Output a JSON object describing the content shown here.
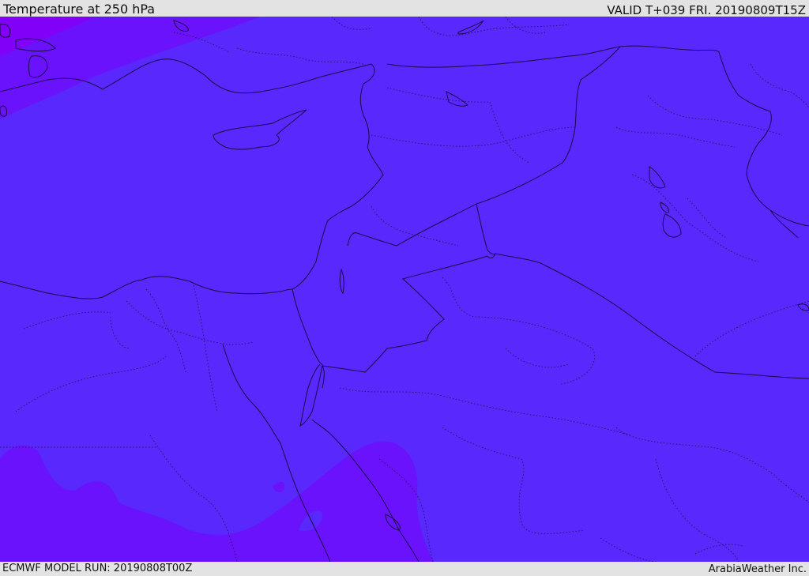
{
  "header": {
    "title": "Temperature at 250 hPa",
    "valid_time": "VALID T+039 FRI. 20190809T15Z"
  },
  "footer": {
    "model_run": "ECMWF MODEL RUN: 20190808T00Z",
    "credit": "ArabiaWeather Inc."
  },
  "map": {
    "region": "Eastern Mediterranean and Middle East",
    "colors": {
      "base": "#5828fc",
      "warm_band": "#6a12fb",
      "warmest": "#8000f8",
      "boundary": "#1a0a4a"
    }
  }
}
